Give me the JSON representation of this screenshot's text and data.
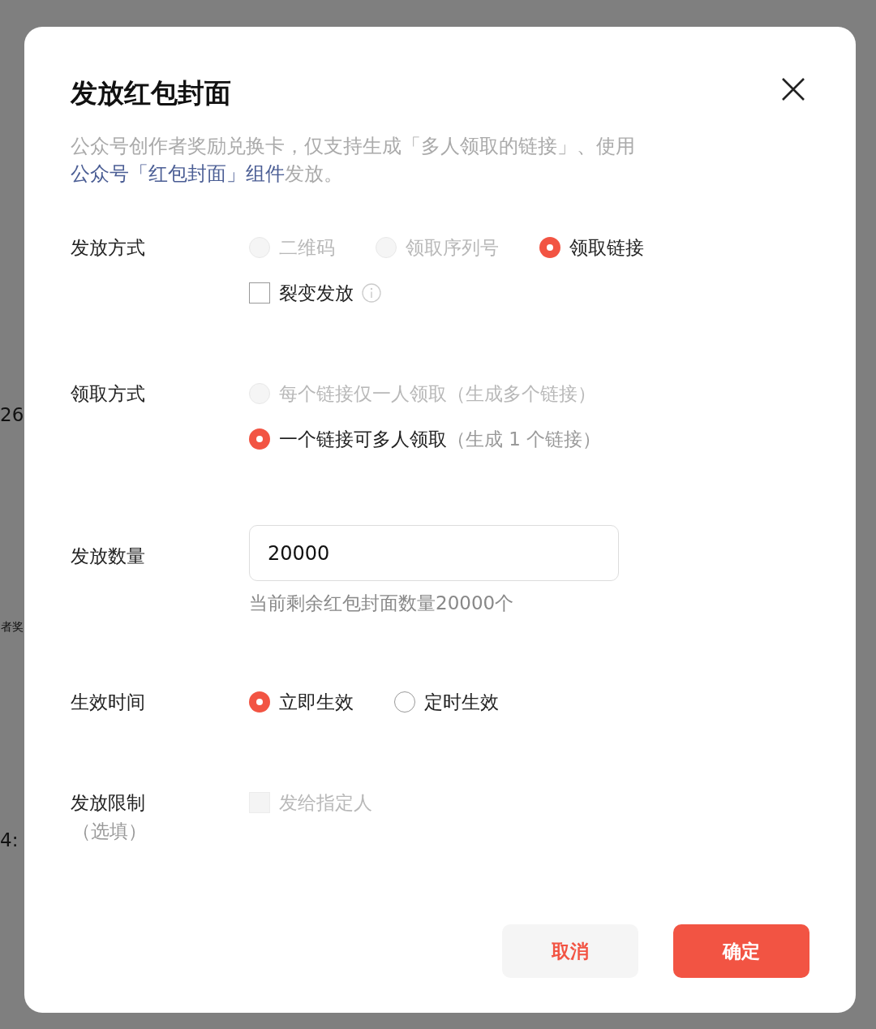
{
  "backdrop": {
    "fragments": [
      "26",
      "者奖",
      "4:"
    ]
  },
  "dialog": {
    "title": "发放红包封面",
    "description": [
      {
        "text": "公众号创作者奖励兑换卡，仅支持生成「多人领取的链接」、使用",
        "kind": "plain"
      },
      {
        "text": "公众号「红包封面」组件",
        "kind": "link"
      },
      {
        "text": "发放。",
        "kind": "plain"
      }
    ],
    "fields": [
      {
        "kind": "choices",
        "label": "发放方式",
        "rows": [
          [
            {
              "kind": "radio",
              "label": "二维码",
              "selected": false,
              "disabled": true
            },
            {
              "kind": "radio",
              "label": "领取序列号",
              "selected": false,
              "disabled": true
            },
            {
              "kind": "radio",
              "label": "领取链接",
              "selected": true,
              "disabled": false
            }
          ],
          [
            {
              "kind": "checkbox",
              "label": "裂变发放",
              "checked": false,
              "disabled": false,
              "info": true
            }
          ]
        ]
      },
      {
        "kind": "choices",
        "label": "领取方式",
        "rows": [
          [
            {
              "kind": "radio",
              "label": "每个链接仅一人领取",
              "note": "（生成多个链接）",
              "selected": false,
              "disabled": true
            }
          ],
          [
            {
              "kind": "radio",
              "label": "一个链接可多人领取",
              "note": "（生成 1 个链接）",
              "selected": true,
              "disabled": false
            }
          ]
        ]
      },
      {
        "kind": "input",
        "label": "发放数量",
        "value": "20000",
        "hint": "当前剩余红包封面数量20000个"
      },
      {
        "kind": "choices",
        "label": "生效时间",
        "rows": [
          [
            {
              "kind": "radio",
              "label": "立即生效",
              "selected": true,
              "disabled": false
            },
            {
              "kind": "radio",
              "label": "定时生效",
              "selected": false,
              "disabled": false
            }
          ]
        ]
      },
      {
        "kind": "choices",
        "label": "发放限制",
        "sublabel": "（选填）",
        "rows": [
          [
            {
              "kind": "checkbox",
              "label": "发给指定人",
              "checked": false,
              "disabled": true
            }
          ]
        ]
      }
    ],
    "buttons": [
      {
        "label": "取消",
        "kind": "secondary"
      },
      {
        "label": "确定",
        "kind": "primary"
      }
    ]
  }
}
